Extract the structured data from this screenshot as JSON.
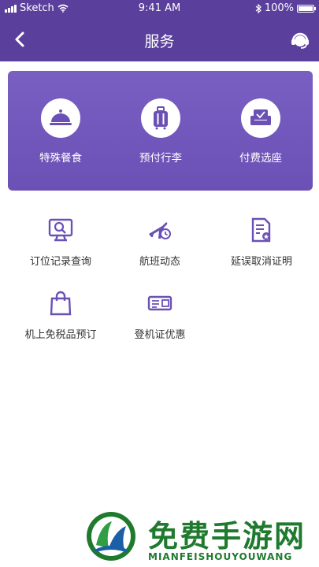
{
  "status_bar": {
    "carrier": "Sketch",
    "time": "9:41 AM",
    "battery": "100%"
  },
  "nav": {
    "title": "服务",
    "back_icon": "chevron-left-icon",
    "service_icon": "headset-icon"
  },
  "featured": [
    {
      "label": "特殊餐食",
      "icon": "food-cloche-icon"
    },
    {
      "label": "预付行李",
      "icon": "luggage-icon"
    },
    {
      "label": "付费选座",
      "icon": "seat-icon"
    }
  ],
  "services": [
    {
      "label": "订位记录查询",
      "icon": "monitor-search-icon"
    },
    {
      "label": "航班动态",
      "icon": "flight-clock-icon"
    },
    {
      "label": "延误取消证明",
      "icon": "document-certificate-icon"
    },
    {
      "label": "机上免税品预订",
      "icon": "shopping-bag-icon"
    },
    {
      "label": "登机证优惠",
      "icon": "boarding-pass-icon"
    }
  ],
  "watermark": {
    "title": "免费手游网",
    "subtitle": "MIANFEISHOUYOUWANG"
  },
  "colors": {
    "header": "#5b3f9c",
    "card": "#7a5fc3",
    "icon_accent": "#6b51b5",
    "watermark": "#1f7a2e"
  }
}
